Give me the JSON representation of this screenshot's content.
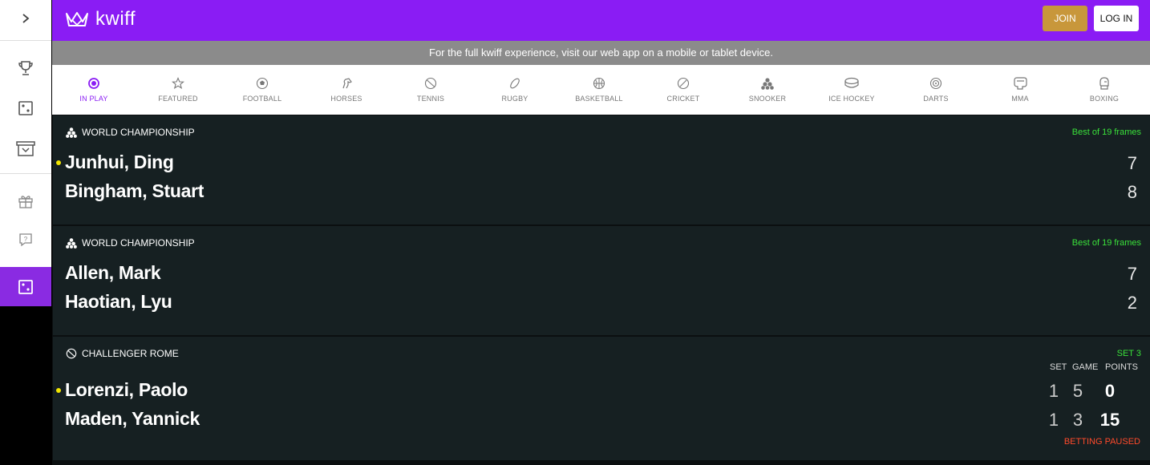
{
  "header": {
    "logo_text": "kwiff",
    "join_label": "JOIN",
    "login_label": "LOG IN"
  },
  "banner": {
    "text": "For the full kwiff experience, visit our web app on a mobile or tablet device."
  },
  "rail": {
    "items": [
      {
        "icon": "chevron-right-icon"
      },
      {
        "icon": "trophy-icon"
      },
      {
        "icon": "dice-icon"
      },
      {
        "icon": "store-icon"
      },
      {
        "icon": "gift-icon"
      },
      {
        "icon": "help-icon"
      },
      {
        "icon": "dice-icon",
        "active": true
      }
    ]
  },
  "sports": [
    {
      "label": "IN PLAY",
      "icon": "in-play-icon",
      "active": true
    },
    {
      "label": "FEATURED",
      "icon": "star-icon"
    },
    {
      "label": "FOOTBALL",
      "icon": "football-icon"
    },
    {
      "label": "HORSES",
      "icon": "horse-icon"
    },
    {
      "label": "TENNIS",
      "icon": "tennis-icon"
    },
    {
      "label": "RUGBY",
      "icon": "rugby-icon"
    },
    {
      "label": "BASKETBALL",
      "icon": "basketball-icon"
    },
    {
      "label": "CRICKET",
      "icon": "cricket-icon"
    },
    {
      "label": "SNOOKER",
      "icon": "snooker-icon"
    },
    {
      "label": "ICE HOCKEY",
      "icon": "ice-hockey-icon"
    },
    {
      "label": "DARTS",
      "icon": "darts-icon"
    },
    {
      "label": "MMA",
      "icon": "mma-icon"
    },
    {
      "label": "BOXING",
      "icon": "boxing-icon"
    }
  ],
  "events": [
    {
      "competition": "WORLD CHAMPIONSHIP",
      "sport_icon": "snooker-icon",
      "status": "Best of 19 frames",
      "players": [
        {
          "name": "Junhui, Ding",
          "score": "7",
          "serving": true
        },
        {
          "name": "Bingham, Stuart",
          "score": "8",
          "serving": false
        }
      ]
    },
    {
      "competition": "WORLD CHAMPIONSHIP",
      "sport_icon": "snooker-icon",
      "status": "Best of 19 frames",
      "players": [
        {
          "name": "Allen, Mark",
          "score": "7",
          "serving": false
        },
        {
          "name": "Haotian, Lyu",
          "score": "2",
          "serving": false
        }
      ]
    },
    {
      "competition": "CHALLENGER ROME",
      "sport_icon": "tennis-icon",
      "status": "SET 3",
      "columns": {
        "set": "SET",
        "game": "GAME",
        "points": "POINTS"
      },
      "players": [
        {
          "name": "Lorenzi, Paolo",
          "set": "1",
          "game": "5",
          "points": "0",
          "serving": true
        },
        {
          "name": "Maden, Yannick",
          "set": "1",
          "game": "3",
          "points": "15",
          "serving": false
        }
      ],
      "notice": "BETTING PAUSED"
    }
  ],
  "colors": {
    "brand": "#8a1cf4",
    "join": "#c8973b",
    "status_green": "#3ae03a",
    "paused_red": "#ff4a2b",
    "card_bg": "#162022"
  }
}
